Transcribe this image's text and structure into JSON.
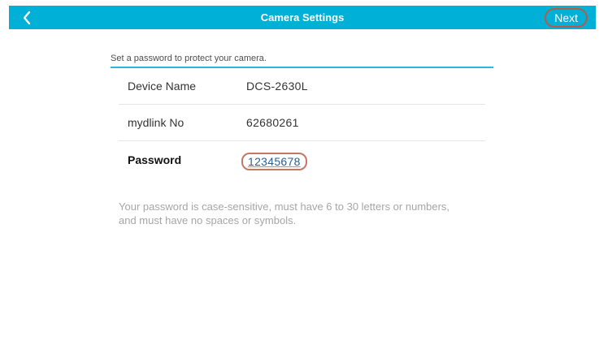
{
  "header": {
    "back_icon": "chevron-left-icon",
    "title": "Camera Settings",
    "next_label": "Next"
  },
  "form": {
    "subtitle": "Set a password to protect your camera.",
    "rows": [
      {
        "label": "Device Name",
        "value": "DCS-2630L"
      },
      {
        "label": "mydlink No",
        "value": "62680261"
      },
      {
        "label": "Password",
        "value": "12345678"
      }
    ],
    "hint_line1": "Your password is case-sensitive, must have 6 to 30 letters or numbers,",
    "hint_line2": "and must have no spaces or symbols."
  },
  "colors": {
    "header_bg": "#00b0d6",
    "accent_rule": "#33b7d8",
    "highlight_outline": "#c47769"
  }
}
